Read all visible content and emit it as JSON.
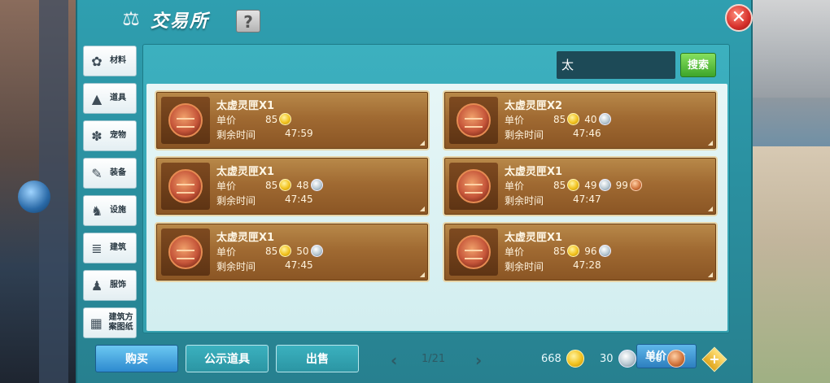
{
  "window": {
    "title": "交易所",
    "help_label": "?",
    "close_label": "✕"
  },
  "sidebar": {
    "items": [
      {
        "label": "材料",
        "icon": "material-icon"
      },
      {
        "label": "道具",
        "icon": "item-icon"
      },
      {
        "label": "宠物",
        "icon": "pet-icon"
      },
      {
        "label": "装备",
        "icon": "equipment-icon"
      },
      {
        "label": "设施",
        "icon": "facility-icon"
      },
      {
        "label": "建筑",
        "icon": "building-icon"
      },
      {
        "label": "服饰",
        "icon": "clothing-icon"
      },
      {
        "label": "建筑方案图纸",
        "icon": "blueprint-icon"
      }
    ]
  },
  "search": {
    "value": "太",
    "button_label": "搜索"
  },
  "listing_labels": {
    "price": "单价",
    "time": "剩余时间"
  },
  "listings": [
    {
      "name": "太虚灵匣X1",
      "gold": "85",
      "silver": "",
      "copper": "",
      "time": "47:59"
    },
    {
      "name": "太虚灵匣X2",
      "gold": "85",
      "silver": "40",
      "copper": "",
      "time": "47:46"
    },
    {
      "name": "太虚灵匣X1",
      "gold": "85",
      "silver": "48",
      "copper": "",
      "time": "47:45"
    },
    {
      "name": "太虚灵匣X1",
      "gold": "85",
      "silver": "49",
      "copper": "99",
      "time": "47:47"
    },
    {
      "name": "太虚灵匣X1",
      "gold": "85",
      "silver": "50",
      "copper": "",
      "time": "47:45"
    },
    {
      "name": "太虚灵匣X1",
      "gold": "85",
      "silver": "96",
      "copper": "",
      "time": "47:28"
    }
  ],
  "pagination": {
    "text": "1/21",
    "prev": "‹",
    "next": "›"
  },
  "sort": {
    "label": "单价"
  },
  "tabs": {
    "buy": "购买",
    "public": "公示道具",
    "sell": "出售"
  },
  "currency": {
    "gold": "668",
    "silver": "30",
    "copper": "66",
    "add_label": "+"
  }
}
